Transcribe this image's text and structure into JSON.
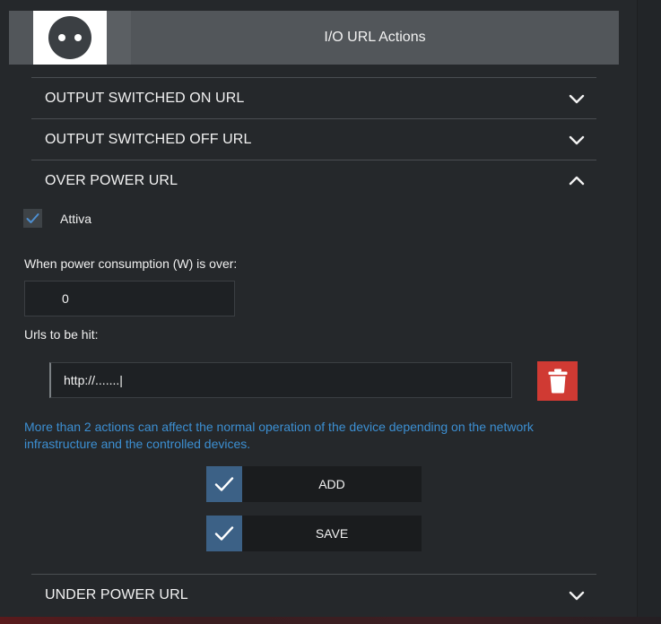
{
  "header": {
    "title": "I/O URL Actions",
    "logo_icon": "power-socket-icon"
  },
  "accordion": {
    "output_on": {
      "label": "OUTPUT SWITCHED ON URL",
      "state": "collapsed"
    },
    "output_off": {
      "label": "OUTPUT SWITCHED OFF URL",
      "state": "collapsed"
    },
    "over_power": {
      "label": "OVER POWER URL",
      "state": "expanded"
    },
    "under_power": {
      "label": "UNDER POWER URL",
      "state": "collapsed"
    }
  },
  "over_power": {
    "enable_label": "Attiva",
    "enabled": true,
    "threshold_label": "When power consumption (W) is over:",
    "threshold_value": "0",
    "urls_label": "Urls to be hit:",
    "urls": [
      "http://.......|"
    ],
    "notice": "More than 2 actions can affect the normal operation of the device depending on the network infrastructure and the controlled devices.",
    "add_label": "ADD",
    "save_label": "SAVE"
  },
  "colors": {
    "background": "#25282b",
    "header": "#52565a",
    "accent_blue": "#3c6186",
    "notice_text": "#3c8fd2",
    "delete_red": "#d03a33"
  }
}
